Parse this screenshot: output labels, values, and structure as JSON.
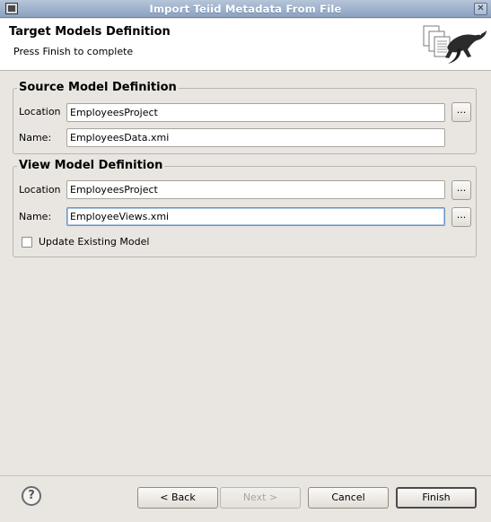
{
  "window": {
    "title": "Import Teiid Metadata From File",
    "close_glyph": "✕"
  },
  "header": {
    "title": "Target Models Definition",
    "subtitle": "Press Finish to complete"
  },
  "source_group": {
    "title": "Source Model Definition",
    "location_label": "Location",
    "location_value": "EmployeesProject",
    "name_label": "Name:",
    "name_value": "EmployeesData.xmi",
    "browse_label": "..."
  },
  "view_group": {
    "title": "View Model Definition",
    "location_label": "Location",
    "location_value": "EmployeesProject",
    "name_label": "Name:",
    "name_value": "EmployeeViews.xmi",
    "browse_label": "...",
    "update_checkbox_label": "Update Existing Model",
    "update_checked": false
  },
  "footer": {
    "help_glyph": "?",
    "back_label": "< Back",
    "next_label": "Next >",
    "cancel_label": "Cancel",
    "finish_label": "Finish"
  },
  "colors": {
    "titlebar": "#8aa2c1",
    "dialog_bg": "#e9e6e1",
    "focus_border": "#6f93c1"
  }
}
